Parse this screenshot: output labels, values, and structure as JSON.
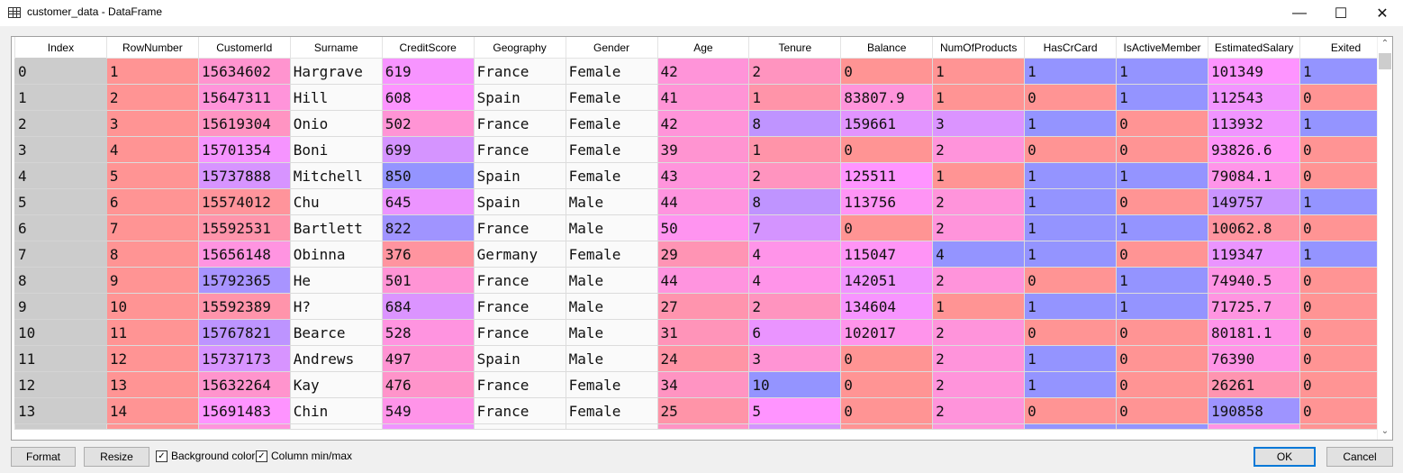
{
  "window": {
    "title": "customer_data - DataFrame",
    "icon": "table-icon",
    "minimize": "—",
    "maximize": "☐",
    "close": "✕"
  },
  "table": {
    "columns": [
      "Index",
      "RowNumber",
      "CustomerId",
      "Surname",
      "CreditScore",
      "Geography",
      "Gender",
      "Age",
      "Tenure",
      "Balance",
      "NumOfProducts",
      "HasCrCard",
      "IsActiveMember",
      "EstimatedSalary",
      "Exited"
    ],
    "rows": [
      [
        "0",
        "1",
        "15634602",
        "Hargrave",
        "619",
        "France",
        "Female",
        "42",
        "2",
        "0",
        "1",
        "1",
        "1",
        "101349",
        "1"
      ],
      [
        "1",
        "2",
        "15647311",
        "Hill",
        "608",
        "Spain",
        "Female",
        "41",
        "1",
        "83807.9",
        "1",
        "0",
        "1",
        "112543",
        "0"
      ],
      [
        "2",
        "3",
        "15619304",
        "Onio",
        "502",
        "France",
        "Female",
        "42",
        "8",
        "159661",
        "3",
        "1",
        "0",
        "113932",
        "1"
      ],
      [
        "3",
        "4",
        "15701354",
        "Boni",
        "699",
        "France",
        "Female",
        "39",
        "1",
        "0",
        "2",
        "0",
        "0",
        "93826.6",
        "0"
      ],
      [
        "4",
        "5",
        "15737888",
        "Mitchell",
        "850",
        "Spain",
        "Female",
        "43",
        "2",
        "125511",
        "1",
        "1",
        "1",
        "79084.1",
        "0"
      ],
      [
        "5",
        "6",
        "15574012",
        "Chu",
        "645",
        "Spain",
        "Male",
        "44",
        "8",
        "113756",
        "2",
        "1",
        "0",
        "149757",
        "1"
      ],
      [
        "6",
        "7",
        "15592531",
        "Bartlett",
        "822",
        "France",
        "Male",
        "50",
        "7",
        "0",
        "2",
        "1",
        "1",
        "10062.8",
        "0"
      ],
      [
        "7",
        "8",
        "15656148",
        "Obinna",
        "376",
        "Germany",
        "Female",
        "29",
        "4",
        "115047",
        "4",
        "1",
        "0",
        "119347",
        "1"
      ],
      [
        "8",
        "9",
        "15792365",
        "He",
        "501",
        "France",
        "Male",
        "44",
        "4",
        "142051",
        "2",
        "0",
        "1",
        "74940.5",
        "0"
      ],
      [
        "9",
        "10",
        "15592389",
        "H?",
        "684",
        "France",
        "Male",
        "27",
        "2",
        "134604",
        "1",
        "1",
        "1",
        "71725.7",
        "0"
      ],
      [
        "10",
        "11",
        "15767821",
        "Bearce",
        "528",
        "France",
        "Male",
        "31",
        "6",
        "102017",
        "2",
        "0",
        "0",
        "80181.1",
        "0"
      ],
      [
        "11",
        "12",
        "15737173",
        "Andrews",
        "497",
        "Spain",
        "Male",
        "24",
        "3",
        "0",
        "2",
        "1",
        "0",
        "76390",
        "0"
      ],
      [
        "12",
        "13",
        "15632264",
        "Kay",
        "476",
        "France",
        "Female",
        "34",
        "10",
        "0",
        "2",
        "1",
        "0",
        "26261",
        "0"
      ],
      [
        "13",
        "14",
        "15691483",
        "Chin",
        "549",
        "France",
        "Female",
        "25",
        "5",
        "0",
        "2",
        "0",
        "0",
        "190858",
        "0"
      ]
    ]
  },
  "footer": {
    "format_label": "Format",
    "resize_label": "Resize",
    "bg_color_label": "Background color",
    "bg_color_checked": true,
    "minmax_label": "Column min/max",
    "minmax_checked": true,
    "ok_label": "OK",
    "cancel_label": "Cancel"
  },
  "colors": {
    "low": "#ff9494",
    "high": "#9494ff",
    "index_bg": "#cccccc",
    "ok_border": "#0078d7"
  }
}
